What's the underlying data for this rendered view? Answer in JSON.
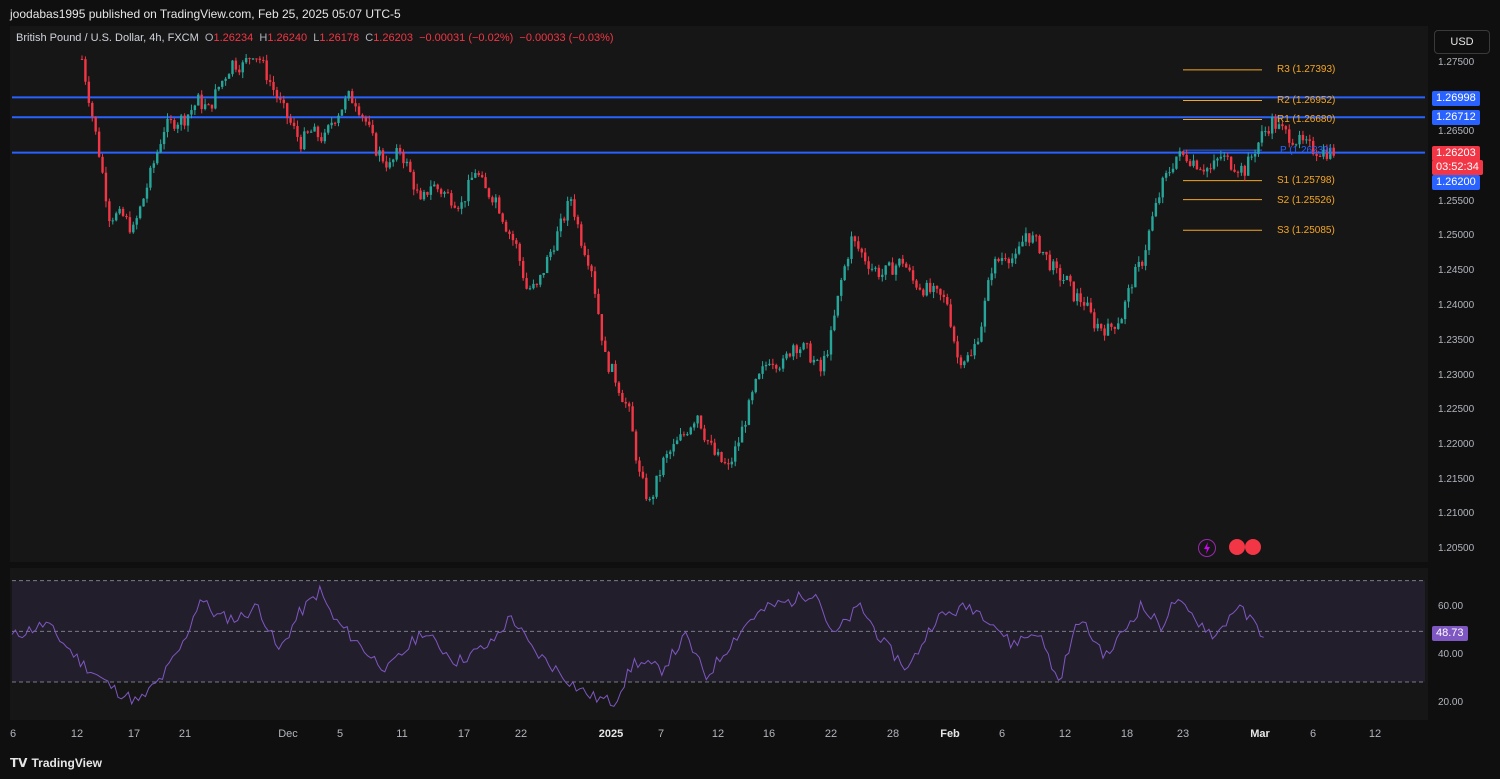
{
  "header": {
    "publish_text": "joodabas1995 published on TradingView.com, Feb 25, 2025 05:07 UTC-5"
  },
  "legend": {
    "symbol": "British Pound / U.S. Dollar, 4h, FXCM",
    "o_label": "O",
    "o_value": "1.26234",
    "h_label": "H",
    "h_value": "1.26240",
    "l_label": "L",
    "l_value": "1.26178",
    "c_label": "C",
    "c_value": "1.26203",
    "change": "−0.00031 (−0.02%)",
    "change2": "−0.00033 (−0.03%)"
  },
  "currency_button": "USD",
  "price_axis": {
    "labels": [
      "1.27500",
      "1.26500",
      "1.25500",
      "1.25000",
      "1.24500",
      "1.24000",
      "1.23500",
      "1.23000",
      "1.22500",
      "1.22000",
      "1.21500",
      "1.21000",
      "1.20500"
    ]
  },
  "price_tags": {
    "line1": "1.26998",
    "line2": "1.26712",
    "current": "1.26203",
    "countdown": "03:52:34",
    "line3": "1.26200"
  },
  "pivots": [
    {
      "label": "R3 (1.27393)",
      "value": 1.27393
    },
    {
      "label": "R2 (1.26952)",
      "value": 1.26952
    },
    {
      "label": "R1 (1.26680)",
      "value": 1.2668
    },
    {
      "label": "P (1.26239)",
      "value": 1.26239
    },
    {
      "label": "S1 (1.25798)",
      "value": 1.25798
    },
    {
      "label": "S2 (1.25526)",
      "value": 1.25526
    },
    {
      "label": "S3 (1.25085)",
      "value": 1.25085
    }
  ],
  "rsi": {
    "axis_labels": [
      "60.00",
      "40.00",
      "20.00"
    ],
    "current": "48.73"
  },
  "time_axis": {
    "labels": [
      "6",
      "12",
      "17",
      "21",
      "Dec",
      "5",
      "11",
      "17",
      "22",
      "2025",
      "7",
      "12",
      "16",
      "22",
      "28",
      "Feb",
      "6",
      "12",
      "18",
      "23",
      "Mar",
      "6",
      "12"
    ]
  },
  "footer": {
    "brand": "TradingView"
  },
  "colors": {
    "up": "#26a69a",
    "down": "#f23645",
    "level_line": "#2962ff",
    "pivot": "#f5a623",
    "rsi": "#7e57c2",
    "background": "#161616"
  },
  "chart_data": {
    "type": "candlestick",
    "symbol": "British Pound / U.S. Dollar",
    "timeframe": "4h",
    "ylim": [
      1.2025,
      1.2785
    ],
    "horizontal_levels": [
      1.26998,
      1.26712,
      1.26203
    ],
    "current_price": 1.26203,
    "path_x": [
      0,
      5,
      8,
      12,
      15,
      18,
      21,
      24,
      27,
      30,
      34,
      37,
      40,
      44,
      47,
      50,
      52,
      55,
      58,
      61,
      64,
      67,
      71,
      73,
      78,
      80,
      83,
      86,
      90,
      93,
      96,
      99,
      102,
      105,
      108,
      111,
      115,
      118,
      121,
      124,
      127,
      130,
      133,
      136,
      140,
      143,
      146,
      149,
      153,
      156,
      160,
      163,
      166,
      170,
      173,
      176,
      180,
      182,
      185,
      189,
      192,
      197,
      201,
      205,
      208,
      212,
      216,
      219,
      222,
      225,
      228,
      231,
      234,
      237,
      240,
      243,
      246,
      250,
      253,
      256,
      260,
      263,
      266,
      270,
      273,
      276,
      280,
      285,
      288,
      290,
      293,
      296,
      300,
      304,
      307,
      310,
      313,
      316,
      320,
      323,
      326,
      330,
      333,
      336,
      340,
      345,
      348,
      350,
      353,
      356,
      360,
      363,
      366
    ],
    "path_y": [
      1.2755,
      1.262,
      1.253,
      1.2528,
      1.2508,
      1.2555,
      1.2605,
      1.2655,
      1.2665,
      1.267,
      1.2695,
      1.2682,
      1.2715,
      1.275,
      1.2745,
      1.2765,
      1.2755,
      1.2722,
      1.269,
      1.2662,
      1.2635,
      1.265,
      1.264,
      1.2665,
      1.27,
      1.2695,
      1.2665,
      1.2625,
      1.26,
      1.2625,
      1.259,
      1.2545,
      1.2575,
      1.2565,
      1.2555,
      1.2545,
      1.2595,
      1.2565,
      1.2555,
      1.2515,
      1.2485,
      1.2425,
      1.2425,
      1.2465,
      1.2515,
      1.2555,
      1.2495,
      1.2455,
      1.2325,
      1.2295,
      1.2245,
      1.2155,
      1.2115,
      1.2175,
      1.2195,
      1.2215,
      1.2245,
      1.2215,
      1.2185,
      1.2165,
      1.2205,
      1.2285,
      1.2325,
      1.2315,
      1.2345,
      1.2335,
      1.2305,
      1.2355,
      1.2435,
      1.2495,
      1.2475,
      1.2455,
      1.2445,
      1.2455,
      1.2465,
      1.2435,
      1.2425,
      1.2415,
      1.2405,
      1.2325,
      1.2325,
      1.2375,
      1.2455,
      1.2475,
      1.2465,
      1.2505,
      1.2485,
      1.2445,
      1.2435,
      1.2415,
      1.2405,
      1.2375,
      1.2365,
      1.2385,
      1.2435,
      1.2465,
      1.2525,
      1.2575,
      1.2615,
      1.2615,
      1.2605,
      1.2595,
      1.2615,
      1.2605,
      1.2595,
      1.2645,
      1.2665,
      1.2655,
      1.2645,
      1.2635,
      1.2625,
      1.2622,
      1.2621
    ],
    "rsi_ylim": [
      15,
      75
    ],
    "rsi_levels": [
      30,
      50,
      70
    ],
    "rsi_current": 48.73,
    "rsi_path_x": [
      0,
      10,
      20,
      30,
      37,
      44,
      50,
      55,
      60,
      66,
      72,
      78,
      84,
      90,
      94,
      100,
      105,
      110,
      120,
      130,
      140,
      146,
      152,
      160,
      165,
      170,
      176,
      182,
      190,
      197,
      203,
      210,
      216,
      222,
      228,
      235,
      240,
      248,
      255,
      262,
      270,
      280,
      286,
      292,
      300,
      306,
      312,
      320,
      330,
      336,
      340,
      346,
      352,
      358,
      364,
      366
    ],
    "rsi_path_y": [
      48,
      53,
      38,
      27,
      22,
      32,
      45,
      63,
      56,
      55,
      60,
      42,
      57,
      66,
      55,
      47,
      40,
      35,
      50,
      38,
      45,
      56,
      43,
      34,
      28,
      24,
      22,
      38,
      35,
      48,
      32,
      45,
      55,
      60,
      62,
      66,
      48,
      60,
      45,
      35,
      55,
      60,
      55,
      45,
      50,
      30,
      55,
      40,
      60,
      52,
      62,
      55,
      48,
      60,
      52,
      48.73
    ]
  }
}
